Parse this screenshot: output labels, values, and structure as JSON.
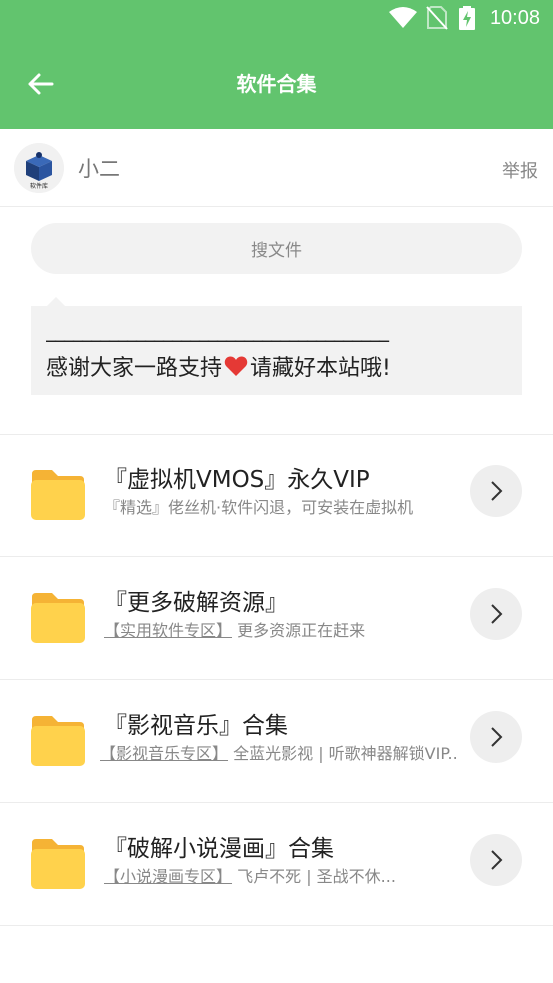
{
  "status_bar": {
    "time": "10:08"
  },
  "app_bar": {
    "title": "软件合集"
  },
  "owner": {
    "name": "小二",
    "avatar_text": "软件库",
    "report_label": "举报"
  },
  "search": {
    "placeholder": "搜文件"
  },
  "notice": {
    "line1": "______________________________________",
    "line2_before": "感谢大家一路支持",
    "line2_after": "请藏好本站哦!"
  },
  "items": [
    {
      "title": "『虚拟机VMOS』永久VIP",
      "tag": "",
      "desc": "『精选』佬丝机·软件闪退，可安装在虚拟机"
    },
    {
      "title": "『更多破解资源』",
      "tag": "【实用软件专区】",
      "desc": " 更多资源正在赶来"
    },
    {
      "title": "『影视音乐』合集",
      "tag": "【影视音乐专区】",
      "desc": " 全蓝光影视 | 听歌神器解锁VIP.."
    },
    {
      "title": "『破解小说漫画』合集",
      "tag": "【小说漫画专区】",
      "desc": " 飞卢不死 | 圣战不休..."
    }
  ],
  "colors": {
    "primary": "#62c46e",
    "folder": "#ffd24c",
    "folder_tab": "#f5b335",
    "heart": "#e53935"
  }
}
